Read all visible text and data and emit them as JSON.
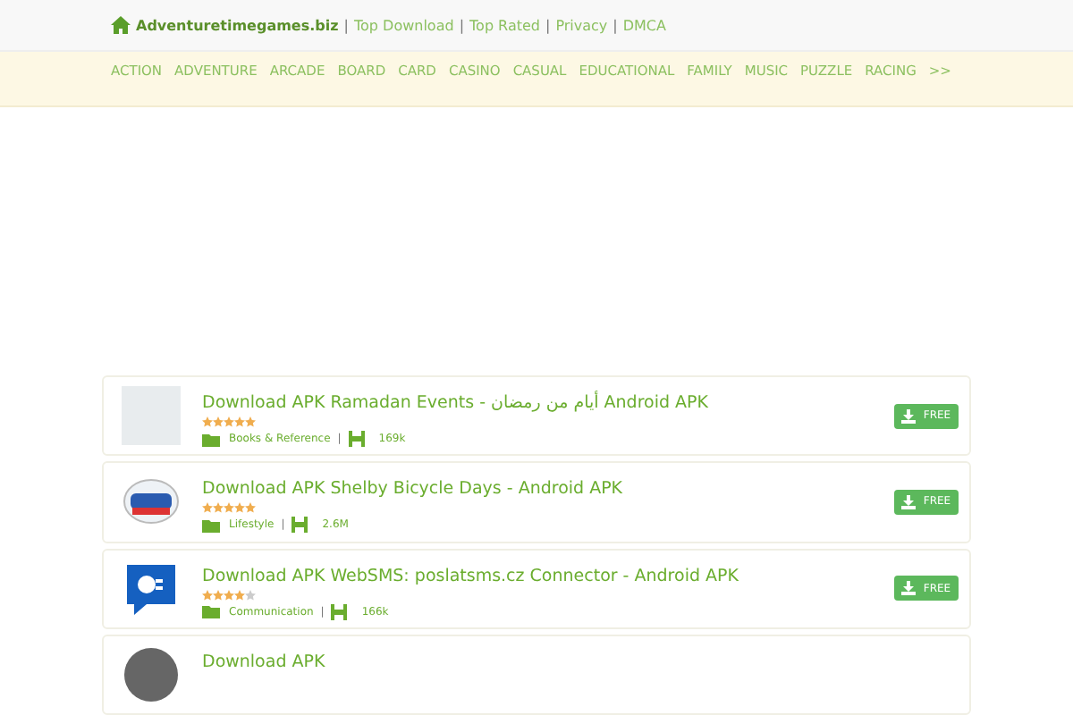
{
  "header": {
    "site": "Adventuretimegames.biz",
    "separator": "|",
    "links": [
      "Top Download",
      "Top Rated",
      "Privacy",
      "DMCA"
    ]
  },
  "categories": [
    "ACTION",
    "ADVENTURE",
    "ARCADE",
    "BOARD",
    "CARD",
    "CASINO",
    "CASUAL",
    "EDUCATIONAL",
    "FAMILY",
    "MUSIC",
    "PUZZLE",
    "RACING",
    ">>"
  ],
  "apps": [
    {
      "title": "Download APK Ramadan Events - أيام من رمضان Android APK",
      "stars": 5,
      "category": "Books & Reference",
      "separator": "|",
      "size": "169k",
      "button": "FREE"
    },
    {
      "title": "Download APK Shelby Bicycle Days - Android APK",
      "stars": 5,
      "category": "Lifestyle",
      "separator": "|",
      "size": "2.6M",
      "button": "FREE"
    },
    {
      "title": "Download APK WebSMS: poslatsms.cz Connector - Android APK",
      "stars": 4,
      "category": "Communication",
      "separator": "|",
      "size": "166k",
      "button": "FREE"
    },
    {
      "title": "Download APK"
    }
  ]
}
